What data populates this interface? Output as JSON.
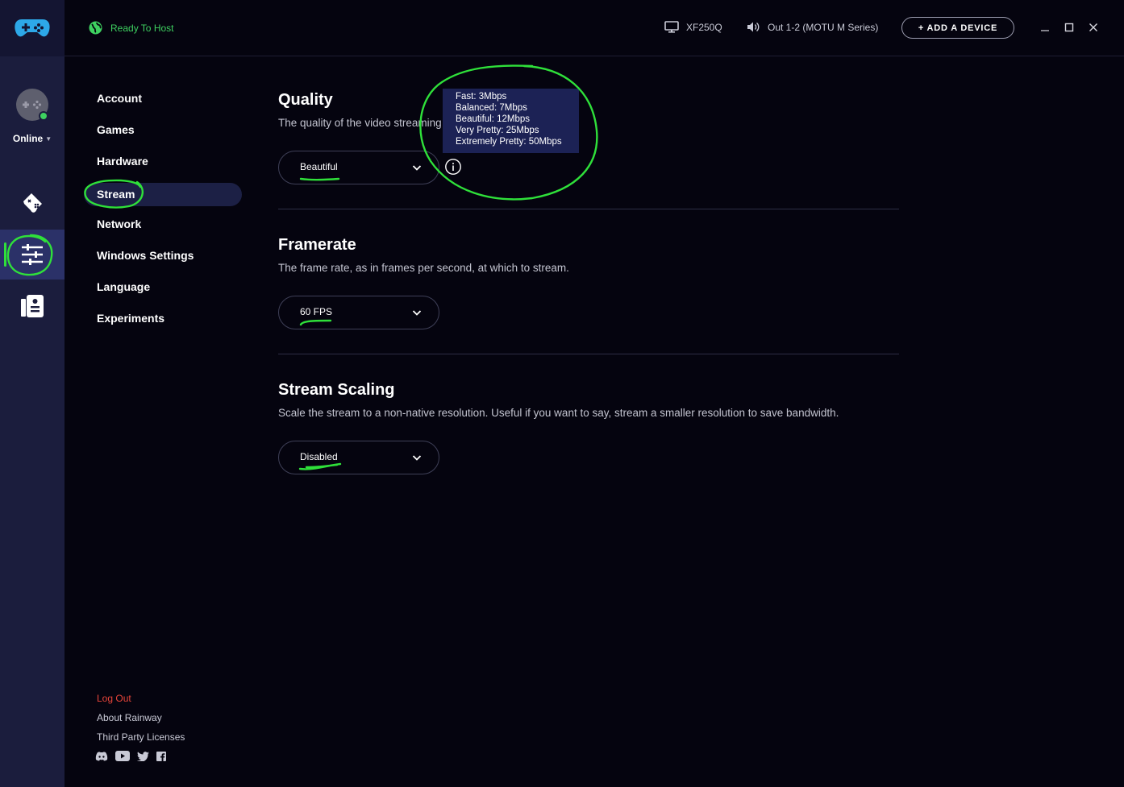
{
  "topbar": {
    "host_status": "Ready To Host",
    "display_device": "XF250Q",
    "audio_device": "Out 1-2 (MOTU M Series)",
    "add_device_label": "+ ADD A DEVICE"
  },
  "rail": {
    "user_status": "Online"
  },
  "settings_nav": {
    "items": [
      "Account",
      "Games",
      "Hardware",
      "Stream",
      "Network",
      "Windows Settings",
      "Language",
      "Experiments"
    ],
    "active": "Stream"
  },
  "footer": {
    "logout": "Log Out",
    "about": "About Rainway",
    "licenses": "Third Party Licenses"
  },
  "stream": {
    "quality": {
      "title": "Quality",
      "description": "The quality of the video streaming",
      "value": "Beautiful",
      "tooltip": [
        "Fast: 3Mbps",
        "Balanced: 7Mbps",
        "Beautiful: 12Mbps",
        "Very Pretty: 25Mbps",
        "Extremely Pretty: 50Mbps"
      ]
    },
    "framerate": {
      "title": "Framerate",
      "description": "The frame rate, as in frames per second, at which to stream.",
      "value": "60 FPS"
    },
    "scaling": {
      "title": "Stream Scaling",
      "description": "Scale the stream to a non-native resolution. Useful if you want to say, stream a smaller resolution to save bandwidth.",
      "value": "Disabled"
    }
  },
  "colors": {
    "accent_green": "#3ed160",
    "annotation_green": "#2fe03a",
    "background": "#05040f",
    "rail": "#1b1d3d",
    "logout_red": "#e8453a"
  }
}
